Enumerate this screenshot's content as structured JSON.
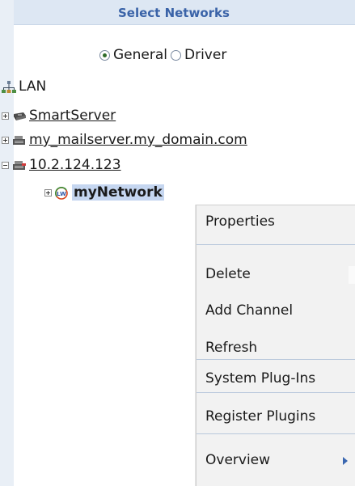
{
  "header": {
    "title": "Select Networks"
  },
  "mode": {
    "options": [
      {
        "label": "General",
        "selected": true
      },
      {
        "label": "Driver",
        "selected": false
      }
    ]
  },
  "tree": {
    "root": {
      "label": "LAN",
      "icon": "lan-icon"
    },
    "nodes": [
      {
        "label": "SmartServer",
        "icon": "smartserver-icon",
        "expanded": false
      },
      {
        "label": "my_mailserver.my_domain.com",
        "icon": "server-icon",
        "expanded": false
      },
      {
        "label": "10.2.124.123",
        "icon": "server-icon",
        "expanded": true
      },
      {
        "label": "myNetwork",
        "icon": "lonworks-network-icon",
        "expanded": false,
        "selected": true
      }
    ]
  },
  "context_menu": {
    "items": [
      {
        "label": "Properties"
      },
      {
        "label": "Delete"
      },
      {
        "label": "Add Channel"
      },
      {
        "label": "Refresh"
      },
      {
        "label": "System Plug-Ins"
      },
      {
        "label": "Register Plugins"
      },
      {
        "label": "Overview",
        "has_submenu": true
      }
    ]
  },
  "colors": {
    "header_bg": "#dde7f3",
    "header_text": "#3a63a8",
    "selection": "#c5d6f0",
    "menu_bg": "#f2f2f2"
  }
}
